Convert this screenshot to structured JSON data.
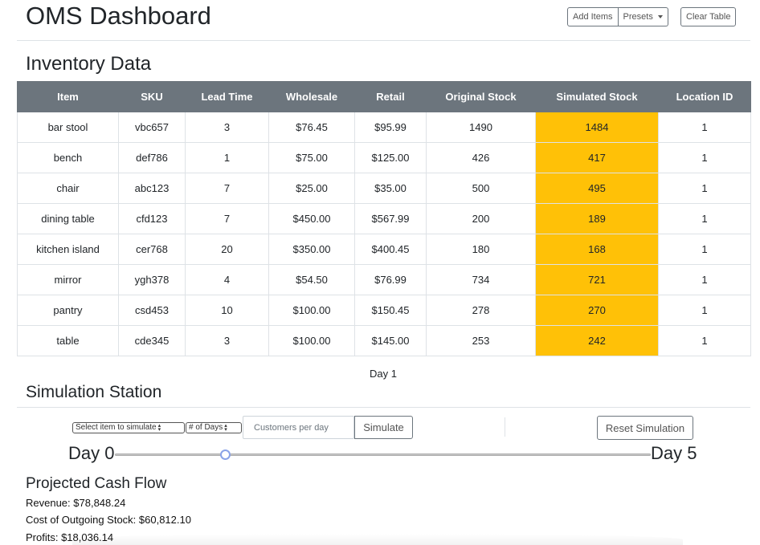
{
  "header": {
    "title": "OMS Dashboard",
    "add_items_label": "Add Items",
    "presets_label": "Presets",
    "clear_table_label": "Clear Table"
  },
  "inventory": {
    "title": "Inventory Data",
    "columns": [
      "Item",
      "SKU",
      "Lead Time",
      "Wholesale",
      "Retail",
      "Original Stock",
      "Simulated Stock",
      "Location ID"
    ],
    "rows": [
      [
        "bar stool",
        "vbc657",
        "3",
        "$76.45",
        "$95.99",
        "1490",
        "1484",
        "1"
      ],
      [
        "bench",
        "def786",
        "1",
        "$75.00",
        "$125.00",
        "426",
        "417",
        "1"
      ],
      [
        "chair",
        "abc123",
        "7",
        "$25.00",
        "$35.00",
        "500",
        "495",
        "1"
      ],
      [
        "dining table",
        "cfd123",
        "7",
        "$450.00",
        "$567.99",
        "200",
        "189",
        "1"
      ],
      [
        "kitchen island",
        "cer768",
        "20",
        "$350.00",
        "$400.45",
        "180",
        "168",
        "1"
      ],
      [
        "mirror",
        "ygh378",
        "4",
        "$54.50",
        "$76.99",
        "734",
        "721",
        "1"
      ],
      [
        "pantry",
        "csd453",
        "10",
        "$100.00",
        "$150.45",
        "278",
        "270",
        "1"
      ],
      [
        "table",
        "cde345",
        "3",
        "$100.00",
        "$145.00",
        "253",
        "242",
        "1"
      ]
    ],
    "highlight_color": "#ffc107",
    "header_color": "#6c757d",
    "day_label": "Day 1"
  },
  "simulation": {
    "title": "Simulation Station",
    "item_select_label": "Select item to simulate",
    "days_select_label": "# of Days",
    "customers_placeholder": "Customers per day",
    "simulate_label": "Simulate",
    "reset_label": "Reset Simulation",
    "day_start_label": "Day 0",
    "day_end_label": "Day 5",
    "slider_min": 0,
    "slider_max": 5,
    "slider_value": 1
  },
  "cash_flow": {
    "title": "Projected Cash Flow",
    "revenue": "Revenue: $78,848.24",
    "cost": "Cost of Outgoing Stock: $60,812.10",
    "profits": "Profits: $18,036.14"
  }
}
